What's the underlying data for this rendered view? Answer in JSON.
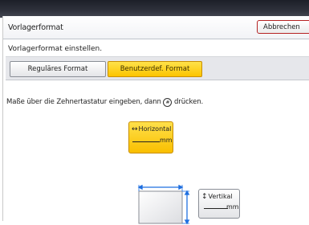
{
  "dialog": {
    "title": "Vorlagerformat",
    "cancel_label": "Abbrechen",
    "subtitle": "Vorlagerformat einstellen."
  },
  "tabs": {
    "regular_label": "Reguläres Format",
    "custom_label": "Benutzerdef. Format",
    "selected": "custom"
  },
  "instruction": {
    "before": "Maße über die Zehnertastatur eingeben, dann ",
    "key_glyph": "#",
    "after": " drücken."
  },
  "fields": {
    "horizontal": {
      "arrow": "↔",
      "label": "Horizontal",
      "unit": "mm",
      "selected": true
    },
    "vertical": {
      "arrow": "↕",
      "label": "Vertikal",
      "unit": "mm",
      "selected": false
    }
  },
  "colors": {
    "selected_yellow": "#fcc400",
    "cancel_border": "#b52222",
    "dimension_blue": "#1f6fe0"
  }
}
